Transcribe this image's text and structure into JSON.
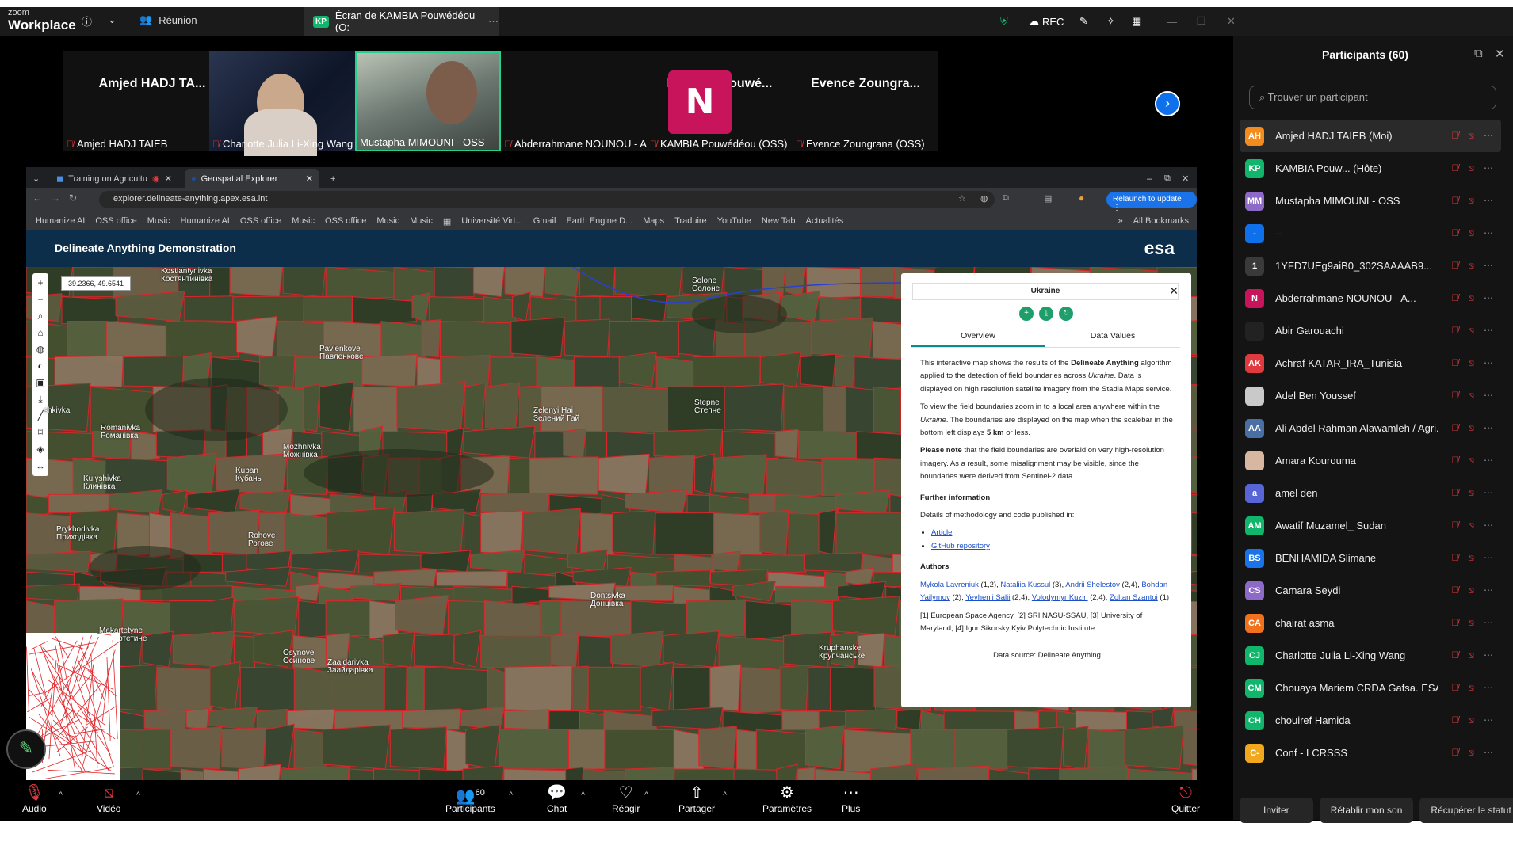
{
  "app": {
    "brand_small": "zoom",
    "brand_name": "Workplace",
    "meeting_tab": "Réunion",
    "share_tab": "Écran de KAMBIA Pouwédéou (O:",
    "host_badge": "KP",
    "rec_label": "REC"
  },
  "gallery": {
    "tiles": [
      {
        "display_name": "Amjed HADJ TA...",
        "label": "Amjed HADJ TAIEB"
      },
      {
        "display_name": "",
        "label": "Charlotte Julia Li-Xing Wang"
      },
      {
        "display_name": "",
        "label": "Mustapha MIMOUNI - OSS"
      },
      {
        "display_name": "N",
        "label": "Abderrahmane NOUNOU - ANS..."
      },
      {
        "display_name": "KAMBIA Pouwé...",
        "label": "KAMBIA Pouwédéou (OSS)"
      },
      {
        "display_name": "Evence  Zoungra...",
        "label": "Evence Zoungrana (OSS)"
      }
    ]
  },
  "browser": {
    "tabs": [
      {
        "label": "Training on Agricultu"
      },
      {
        "label": "Geospatial Explorer"
      }
    ],
    "url": "explorer.delineate-anything.apex.esa.int",
    "relaunch": "Relaunch to update",
    "bookmarks": [
      "Humanize AI",
      "OSS office",
      "Music",
      "Humanize AI",
      "OSS office",
      "Music",
      "OSS office",
      "Music",
      "Music",
      "Université Virt...",
      "Gmail",
      "Earth Engine D...",
      "Maps",
      "Traduire",
      "YouTube",
      "New Tab",
      "Actualités",
      "All Bookmarks"
    ]
  },
  "app_page": {
    "title": "Delineate Anything Demonstration",
    "logo": "esa",
    "coords": "39.2366, 49.6541"
  },
  "map_labels": [
    {
      "text": "Kostiantynivka"
    },
    {
      "text": "Костянтинівка"
    },
    {
      "text": "Pavlenkove"
    },
    {
      "text": "Павленкове"
    },
    {
      "text": "Solone"
    },
    {
      "text": "Солоне"
    },
    {
      "text": "Romanivka"
    },
    {
      "text": "Романівка"
    },
    {
      "text": "Mozhnivka"
    },
    {
      "text": "Можнівка"
    },
    {
      "text": "Zelenyi Hai"
    },
    {
      "text": "Зелений Гай"
    },
    {
      "text": "Stepne"
    },
    {
      "text": "Степне"
    },
    {
      "text": "Kuban"
    },
    {
      "text": "Кубань"
    },
    {
      "text": "Kulyshivka"
    },
    {
      "text": "Клинівка"
    },
    {
      "text": "Prykhodivka"
    },
    {
      "text": "Приходівка"
    },
    {
      "text": "Rohove"
    },
    {
      "text": "Рогове"
    },
    {
      "text": "Makartetyne"
    },
    {
      "text": "Макартетине"
    },
    {
      "text": "Dontsivka"
    },
    {
      "text": "Донцівка"
    },
    {
      "text": "Osynove"
    },
    {
      "text": "Осинове"
    },
    {
      "text": "Zaaidarivka"
    },
    {
      "text": "Заайдарівка"
    },
    {
      "text": "Kruphanske"
    },
    {
      "text": "Крупчанське"
    },
    {
      "text": "shkivka"
    }
  ],
  "info_panel": {
    "title": "Ukraine",
    "tabs": [
      "Overview",
      "Data Values"
    ],
    "p1a": "This interactive map shows the results of the ",
    "p1b": "Delineate Anything",
    "p1c": " algorithm applied to the detection of field boundaries across ",
    "p1d": "Ukraine",
    "p1e": ". Data is displayed on high resolution satellite imagery from the Stadia Maps service.",
    "p2a": "To view the field boundaries zoom in to a local area anywhere within the ",
    "p2b": "Ukraine",
    "p2c": ". The boundaries are displayed on the map when the scalebar in the bottom left displays ",
    "p2d": "5 km",
    "p2e": " or less.",
    "p3a": "Please note",
    "p3b": " that the field boundaries are overlaid on very high-resolution imagery. As a result, some misalignment may be visible, since the boundaries were derived from Sentinel-2 data.",
    "further_heading": "Further information",
    "further_text": "Details of methodology and code published in:",
    "links": [
      "Article",
      "GitHub repository"
    ],
    "authors_heading": "Authors",
    "authors": [
      {
        "name": "Mykola Lavreniuk",
        "aff": " (1,2), "
      },
      {
        "name": "Nataliia Kussul",
        "aff": " (3), "
      },
      {
        "name": "Andrii Shelestov",
        "aff": " (2,4), "
      },
      {
        "name": "Bohdan Yailymov",
        "aff": " (2), "
      },
      {
        "name": "Yevhenii Salii",
        "aff": " (2,4), "
      },
      {
        "name": "Volodymyr Kuzin",
        "aff": " (2,4), "
      },
      {
        "name": "Zoltan Szantoi",
        "aff": " (1)"
      }
    ],
    "affiliations": "[1] European Space Agency, [2] SRI NASU-SSAU, [3] University of Maryland, [4] Igor Sikorsky Kyiv Polytechnic Institute",
    "data_source": "Data source: Delineate Anything"
  },
  "participants": {
    "header": "Participants (60)",
    "search_placeholder": "Trouver un participant",
    "list": [
      {
        "initials": "AH",
        "name": "Amjed HADJ TAIEB (Moi)",
        "color": "#f28c1e"
      },
      {
        "initials": "KP",
        "name": "KAMBIA Pouw... (Hôte)",
        "color": "#12b56c"
      },
      {
        "initials": "MM",
        "name": "Mustapha MIMOUNI - OSS",
        "color": "#8e6ac8"
      },
      {
        "initials": "-",
        "name": "--",
        "color": "#0e71eb"
      },
      {
        "initials": "1",
        "name": "1YFD7UEg9aiB0_302SAAAAB9...",
        "color": "#3a3a3a"
      },
      {
        "initials": "N",
        "name": "Abderrahmane NOUNOU - A...",
        "color": "#c8145a"
      },
      {
        "initials": "",
        "name": "Abir Garouachi",
        "color": "#222"
      },
      {
        "initials": "AK",
        "name": "Achraf KATAR_IRA_Tunisia",
        "color": "#e0393e"
      },
      {
        "initials": "",
        "name": "Adel Ben Youssef",
        "color": "#c9c9c9"
      },
      {
        "initials": "AA",
        "name": "Ali Abdel Rahman Alawamleh / Agri...",
        "color": "#4a6fa5"
      },
      {
        "initials": "",
        "name": "Amara Kourouma",
        "color": "#d8b7a0"
      },
      {
        "initials": "a",
        "name": "amel den",
        "color": "#5865d6"
      },
      {
        "initials": "AM",
        "name": "Awatif Muzamel_ Sudan",
        "color": "#12b56c"
      },
      {
        "initials": "BS",
        "name": "BENHAMIDA Slimane",
        "color": "#1a73e8"
      },
      {
        "initials": "CS",
        "name": "Camara Seydi",
        "color": "#8e6ac8"
      },
      {
        "initials": "CA",
        "name": "chairat asma",
        "color": "#f2711c"
      },
      {
        "initials": "CJ",
        "name": "Charlotte Julia Li-Xing Wang",
        "color": "#12b56c"
      },
      {
        "initials": "CM",
        "name": "Chouaya Mariem CRDA Gafsa. ESA",
        "color": "#12b56c"
      },
      {
        "initials": "CH",
        "name": "chouiref Hamida",
        "color": "#12b56c"
      },
      {
        "initials": "C-",
        "name": "Conf - LCRSSS",
        "color": "#f2a81c"
      }
    ],
    "invite": "Inviter",
    "unmute": "Rétablir mon son",
    "reclaim": "Récupérer le statut d'hôte"
  },
  "toolbar": {
    "audio": "Audio",
    "video": "Vidéo",
    "participants": "Participants",
    "participants_count": "60",
    "chat": "Chat",
    "react": "Réagir",
    "share": "Partager",
    "settings": "Paramètres",
    "more": "Plus",
    "quit": "Quitter"
  }
}
